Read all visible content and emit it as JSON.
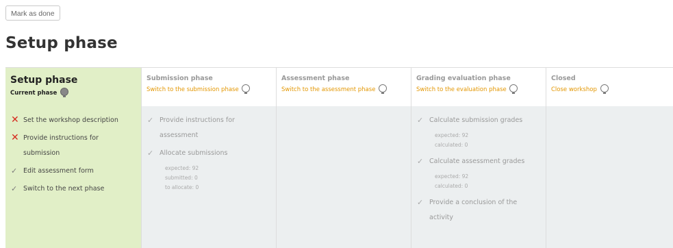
{
  "mark_as_done": "Mark as done",
  "page_title": "Setup phase",
  "phases": {
    "setup": {
      "title": "Setup phase",
      "status": "Current phase",
      "tasks": [
        {
          "label": "Set the workshop description"
        },
        {
          "label": "Provide instructions for submission"
        },
        {
          "label": "Edit assessment form"
        },
        {
          "label": "Switch to the next phase"
        }
      ]
    },
    "submission": {
      "title": "Submission phase",
      "switch": "Switch to the submission phase",
      "tasks": [
        {
          "label": "Provide instructions for assessment"
        },
        {
          "label": "Allocate submissions",
          "details": [
            "expected: 92",
            "submitted: 0",
            "to allocate: 0"
          ]
        }
      ]
    },
    "assessment": {
      "title": "Assessment phase",
      "switch": "Switch to the assessment phase"
    },
    "grading": {
      "title": "Grading evaluation phase",
      "switch": "Switch to the evaluation phase",
      "tasks": [
        {
          "label": "Calculate submission grades",
          "details": [
            "expected: 92",
            "calculated: 0"
          ]
        },
        {
          "label": "Calculate assessment grades",
          "details": [
            "expected: 92",
            "calculated: 0"
          ]
        },
        {
          "label": "Provide a conclusion of the activity"
        }
      ]
    },
    "closed": {
      "title": "Closed",
      "switch": "Close workshop"
    }
  }
}
